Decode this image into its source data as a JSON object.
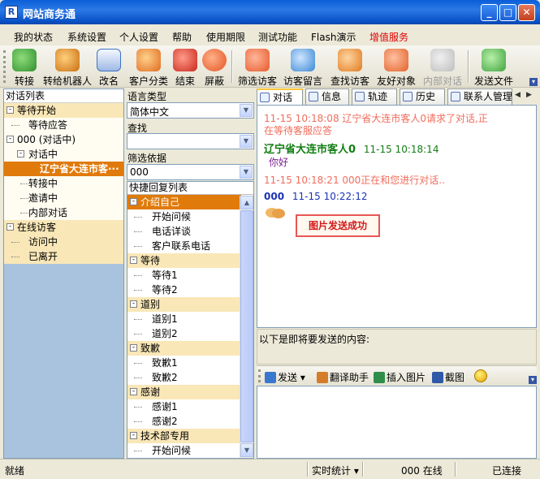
{
  "window": {
    "title": "网站商务通",
    "icon_letter": "R"
  },
  "menu": [
    "我的状态",
    "系统设置",
    "个人设置",
    "帮助",
    "使用期限",
    "测试功能",
    "Flash演示",
    "增值服务"
  ],
  "toolbar": [
    {
      "label": "转接",
      "icon": "transfer-icon",
      "color": "#3c9b3c",
      "disabled": false
    },
    {
      "label": "转给机器人",
      "icon": "robot-icon",
      "color": "#d7862a",
      "disabled": false
    },
    {
      "label": "改名",
      "icon": "rename-card-icon",
      "color": "#3d73c2",
      "disabled": false
    },
    {
      "label": "客户分类",
      "icon": "customer-group-icon",
      "color": "#e06c20",
      "disabled": false
    },
    {
      "label": "结束",
      "icon": "end-icon",
      "color": "#d9321f",
      "disabled": false
    },
    {
      "label": "屏蔽",
      "icon": "block-icon",
      "color": "#e4531f",
      "disabled": false
    },
    {
      "label": "筛选访客",
      "icon": "filter-visitor-icon",
      "color": "#e55a2a",
      "disabled": false
    },
    {
      "label": "访客留言",
      "icon": "visitor-message-icon",
      "color": "#3a87d4",
      "disabled": false
    },
    {
      "label": "查找访客",
      "icon": "search-visitor-icon",
      "color": "#e07a20",
      "disabled": false
    },
    {
      "label": "友好对象",
      "icon": "friendly-object-icon",
      "color": "#e2622a",
      "disabled": false
    },
    {
      "label": "内部对话",
      "icon": "internal-chat-icon",
      "color": "#bdbdbd",
      "disabled": true
    },
    {
      "label": "发送文件",
      "icon": "send-file-icon",
      "color": "#3fa33f",
      "disabled": false
    }
  ],
  "conv_list": {
    "header": "对话列表",
    "rows": [
      {
        "text": "等待开始",
        "level": 0,
        "kind": "group",
        "box": "-"
      },
      {
        "text": "等待应答",
        "level": 1,
        "kind": "leaf"
      },
      {
        "text": "000 (对话中)",
        "level": 0,
        "kind": "plain",
        "box": "-"
      },
      {
        "text": "对话中",
        "level": 1,
        "kind": "plain",
        "box": "-"
      },
      {
        "text": "辽宁省大连市客···",
        "level": 2,
        "kind": "selected"
      },
      {
        "text": "转接中",
        "level": 1,
        "kind": "leaf"
      },
      {
        "text": "邀请中",
        "level": 1,
        "kind": "leaf"
      },
      {
        "text": "内部对话",
        "level": 1,
        "kind": "leaf"
      },
      {
        "text": "在线访客",
        "level": 0,
        "kind": "group",
        "box": "-"
      },
      {
        "text": "访问中",
        "level": 1,
        "kind": "leaf"
      },
      {
        "text": "已离开",
        "level": 1,
        "kind": "leaf"
      }
    ]
  },
  "language": {
    "label": "语言类型",
    "value": "简体中文"
  },
  "search": {
    "label": "查找",
    "value": ""
  },
  "filter": {
    "label": "筛选依据",
    "value": "000"
  },
  "quick_reply": {
    "header": "快捷回复列表",
    "rows": [
      {
        "text": "介绍自己",
        "kind": "cat",
        "active": true
      },
      {
        "text": "开始问候",
        "kind": "item"
      },
      {
        "text": "电话详谈",
        "kind": "item"
      },
      {
        "text": "客户联系电话",
        "kind": "item"
      },
      {
        "text": "等待",
        "kind": "cat"
      },
      {
        "text": "等待1",
        "kind": "item"
      },
      {
        "text": "等待2",
        "kind": "item"
      },
      {
        "text": "道别",
        "kind": "cat"
      },
      {
        "text": "道别1",
        "kind": "item"
      },
      {
        "text": "道别2",
        "kind": "item"
      },
      {
        "text": "致歉",
        "kind": "cat"
      },
      {
        "text": "致歉1",
        "kind": "item"
      },
      {
        "text": "致歉2",
        "kind": "item"
      },
      {
        "text": "感谢",
        "kind": "cat"
      },
      {
        "text": "感谢1",
        "kind": "item"
      },
      {
        "text": "感谢2",
        "kind": "item"
      },
      {
        "text": "技术部专用",
        "kind": "cat"
      },
      {
        "text": "开始问候",
        "kind": "item"
      }
    ]
  },
  "tabs": [
    "对话",
    "信息",
    "轨迹",
    "历史",
    "联系人管理"
  ],
  "chat": {
    "msg1_line1": "11-15 10:18:08  辽宁省大连市客人0请求了对话,正",
    "msg1_line2": "在等待客服应答",
    "msg2_header": "辽宁省大连市客人0",
    "msg2_time": "11-15 10:18:14",
    "msg2_text": "你好",
    "msg3": "11-15 10:18:21  000正在和您进行对话..",
    "msg4_sender": "000",
    "msg4_time": "11-15 10:22:12",
    "image_sent": "图片发送成功"
  },
  "compose": {
    "label": "以下是即将要发送的内容:",
    "send": "发送",
    "translate": "翻译助手",
    "insert_image": "插入图片",
    "screenshot": "截图"
  },
  "status": {
    "left": "就绪",
    "stats": "实时统计",
    "online": "000 在线",
    "connected": "已连接"
  }
}
